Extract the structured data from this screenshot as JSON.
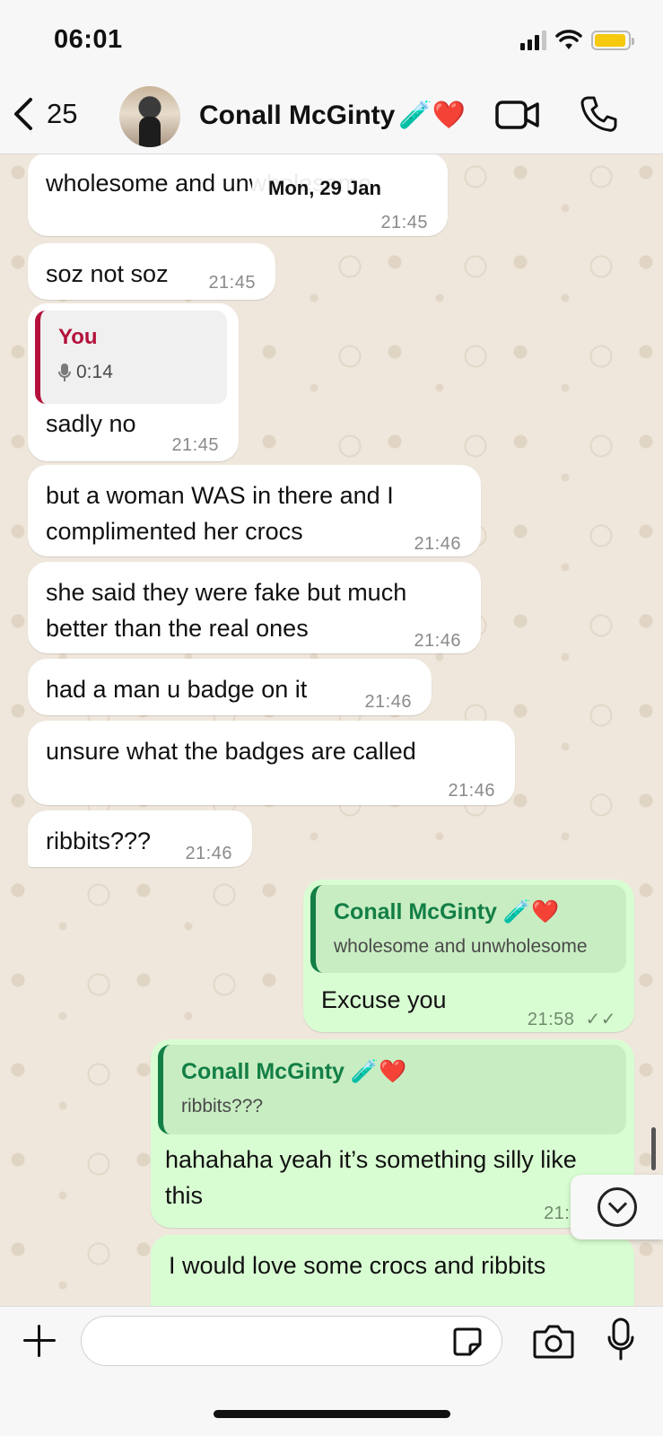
{
  "status_bar": {
    "time": "06:01",
    "battery_level": 0.95,
    "battery_color": "#f6c90e"
  },
  "header": {
    "back_count": "25",
    "contact_name": "Conall McGinty",
    "name_emoji": "🧪❤️",
    "icons": [
      "chevron-left-icon",
      "video-call-icon",
      "phone-icon"
    ]
  },
  "chat": {
    "date_pill": "Mon, 29 Jan",
    "incoming": [
      {
        "text": "wholesome and unwholesome",
        "time": "21:45"
      },
      {
        "text": "soz not soz",
        "time": "21:45"
      },
      {
        "quote_author": "You",
        "quote_text": "0:14",
        "text": "sadly no",
        "time": "21:45"
      },
      {
        "text": "but a woman WAS in there and I complimented her crocs",
        "time": "21:46"
      },
      {
        "text": "she said they were fake but much better than the real ones",
        "time": "21:46"
      },
      {
        "text": "had a man u badge on it",
        "time": "21:46"
      },
      {
        "text": "unsure what the badges are called",
        "time": "21:46"
      },
      {
        "text": "ribbits???",
        "time": "21:46"
      }
    ],
    "outgoing": [
      {
        "quote_author": "Conall McGinty 🧪❤️",
        "quote_text": "wholesome and unwholesome",
        "text": "Excuse you",
        "time": "21:58",
        "ticks": "✓✓"
      },
      {
        "quote_author": "Conall McGinty 🧪❤️",
        "quote_text": "ribbits???",
        "text": "hahahaha yeah it’s something silly like this",
        "time": "21:5"
      },
      {
        "text": "I would love some crocs and ribbits"
      }
    ]
  },
  "composer": {
    "input_value": ""
  },
  "colors": {
    "incoming_bubble": "#ffffff",
    "outgoing_bubble": "#d9fdd3",
    "quote_red": "#b3113b",
    "quote_green": "#137f46"
  }
}
